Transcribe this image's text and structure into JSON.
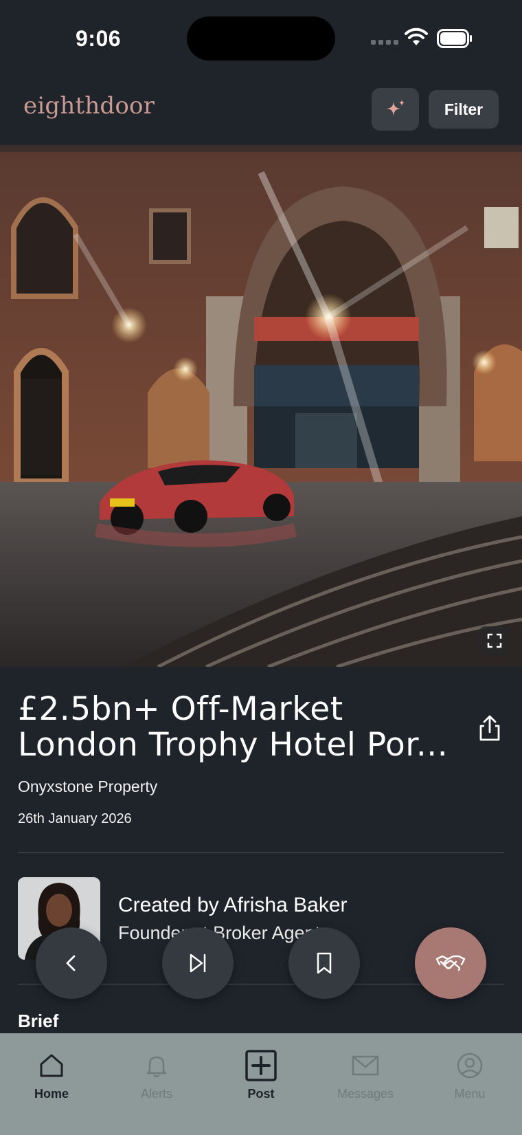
{
  "status_bar": {
    "time": "9:06"
  },
  "header": {
    "logo": "eighthdoor",
    "ai_icon": "sparkle-icon",
    "filter_label": "Filter"
  },
  "listing": {
    "title_line1": "£2.5bn+ Off-Market",
    "title_line2": "London Trophy Hotel Por...",
    "company": "Onyxstone Property",
    "date": "26th January 2026",
    "creator": "Created by Afrisha Baker",
    "role": "Founder at Broker Agent",
    "section_heading": "Brief"
  },
  "actions": {
    "back_icon": "chevron-left-icon",
    "skip_icon": "skip-forward-icon",
    "bookmark_icon": "bookmark-icon",
    "deal_icon": "handshake-icon"
  },
  "nav": {
    "items": [
      {
        "label": "Home",
        "icon": "home-icon",
        "state": "active"
      },
      {
        "label": "Alerts",
        "icon": "bell-icon",
        "state": "dim"
      },
      {
        "label": "Post",
        "icon": "plus-square-icon",
        "state": "active"
      },
      {
        "label": "Messages",
        "icon": "mail-icon",
        "state": "dim"
      },
      {
        "label": "Menu",
        "icon": "user-circle-icon",
        "state": "dim"
      }
    ]
  },
  "colors": {
    "background": "#1f242b",
    "logo": "#c99b92",
    "accent_fab": "#a87872",
    "nav_bg": "#8d9a99"
  }
}
